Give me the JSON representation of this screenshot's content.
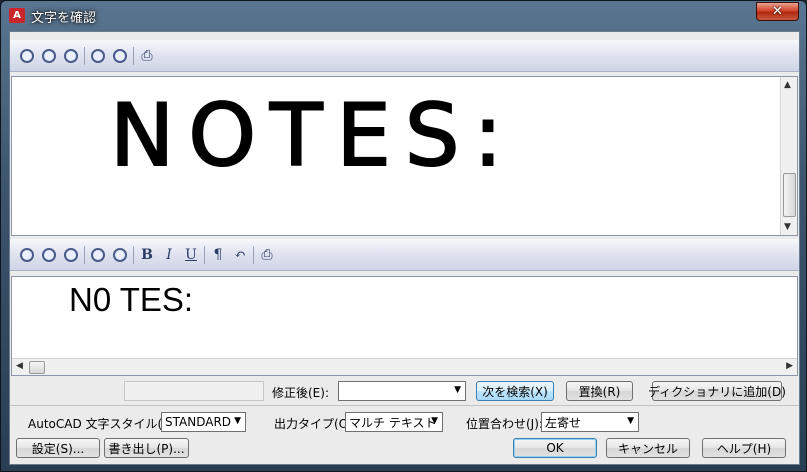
{
  "window": {
    "title": "文字を確認",
    "close_symbol": "✕"
  },
  "top_toolbar": {
    "buttons": [
      "zoom-out-icon",
      "zoom-extents-icon",
      "zoom-window-icon",
      "zoom-in-icon",
      "zoom-previous-icon",
      "print-icon"
    ]
  },
  "preview": {
    "text": "NOTES:"
  },
  "edit_toolbar": {
    "bold": "B",
    "italic": "I",
    "underline": "U",
    "paragraph": "¶",
    "undo": "↶"
  },
  "edit": {
    "text": "N0 TES:"
  },
  "correction_row": {
    "original_field_value": "",
    "label": "修正後(E):",
    "input_value": "",
    "find_next": "次を検索(X)",
    "replace": "置換(R)",
    "add_dictionary": "ディクショナリに追加(D)"
  },
  "options_row": {
    "style_label": "AutoCAD 文字スタイル(U):",
    "style_value": "STANDARD",
    "output_label": "出力タイプ(O):",
    "output_value": "マルチ テキスト",
    "align_label": "位置合わせ(J):",
    "align_value": "左寄せ"
  },
  "button_row": {
    "settings": "設定(S)...",
    "export": "書き出し(P)...",
    "ok": "OK",
    "cancel": "キャンセル",
    "help": "ヘルプ(H)"
  }
}
